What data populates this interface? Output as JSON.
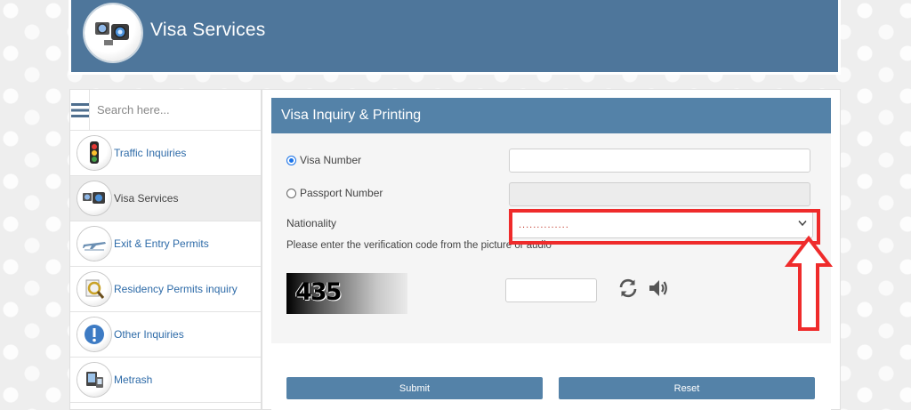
{
  "header": {
    "title": "Visa Services",
    "logo_icon": "visa-services-logo-icon"
  },
  "sidebar": {
    "search_placeholder": "Search here...",
    "items": [
      {
        "label": "Traffic Inquiries",
        "icon": "traffic-light-icon",
        "active": false
      },
      {
        "label": "Visa Services",
        "icon": "visa-services-icon",
        "active": true
      },
      {
        "label": "Exit & Entry Permits",
        "icon": "airplane-icon",
        "active": false
      },
      {
        "label": "Residency Permits inquiry",
        "icon": "magnifier-icon",
        "active": false
      },
      {
        "label": "Other Inquiries",
        "icon": "exclamation-icon",
        "active": false
      },
      {
        "label": "Metrash",
        "icon": "metrash-icon",
        "active": false
      }
    ]
  },
  "form": {
    "title": "Visa Inquiry & Printing",
    "visa_number_label": "Visa Number",
    "passport_number_label": "Passport Number",
    "nationality_label": "Nationality",
    "nationality_value": "..............",
    "verification_text": "Please enter the verification code from the picture or audio",
    "captcha_text": "435",
    "submit_label": "Submit",
    "reset_label": "Reset"
  },
  "colors": {
    "header_bg": "#4e769b",
    "panel_header_bg": "#5482a8",
    "link": "#2e6ba8",
    "highlight": "#ef2b2b"
  }
}
